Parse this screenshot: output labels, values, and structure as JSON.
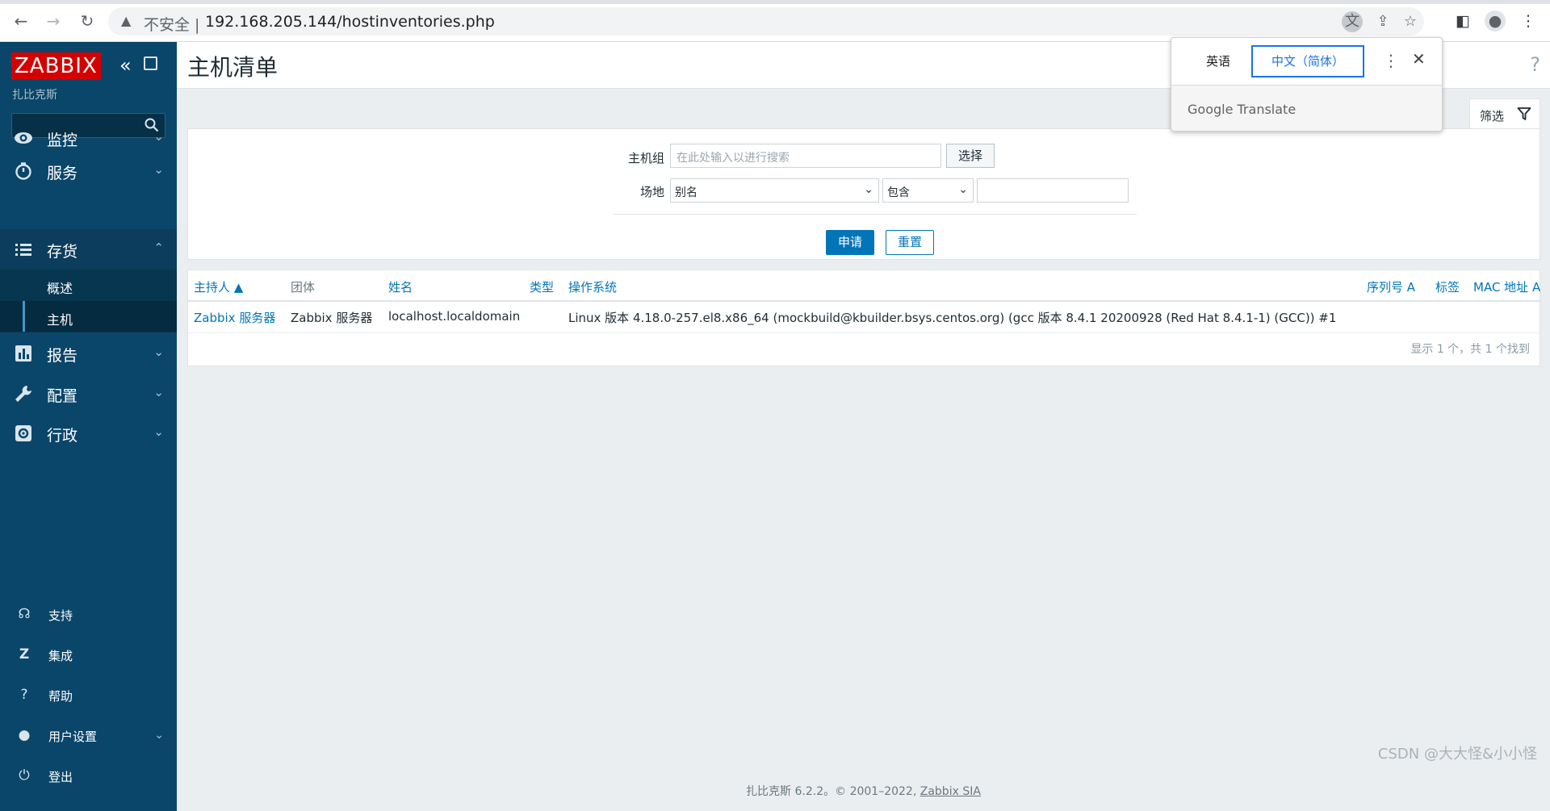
{
  "browser": {
    "insecure_label": "不安全 |",
    "url": "192.168.205.144/hostinventories.php"
  },
  "sidebar": {
    "logo": "ZABBIX",
    "subtitle": "扎比克斯",
    "search_placeholder": "",
    "menu": [
      {
        "label": "监控",
        "icon": "eye-icon"
      },
      {
        "label": "服务",
        "icon": "stopwatch-icon"
      },
      {
        "label": "存货",
        "icon": "list-icon"
      },
      {
        "label": "报告",
        "icon": "bar-chart-icon"
      },
      {
        "label": "配置",
        "icon": "wrench-icon"
      },
      {
        "label": "行政",
        "icon": "gear-icon"
      }
    ],
    "submenu": [
      {
        "label": "概述"
      },
      {
        "label": "主机"
      }
    ],
    "bottom": [
      {
        "label": "支持",
        "icon": "headset-icon"
      },
      {
        "label": "集成",
        "icon": "integrations-icon"
      },
      {
        "label": "帮助",
        "icon": "help-icon"
      },
      {
        "label": "用户设置",
        "icon": "user-icon"
      },
      {
        "label": "登出",
        "icon": "power-icon"
      }
    ]
  },
  "header": {
    "title": "主机清单",
    "help": "?"
  },
  "filter": {
    "tab_label": "筛选",
    "host_group_label": "主机组",
    "host_group_placeholder": "在此处输入以进行搜索",
    "select_button": "选择",
    "field_label": "场地",
    "field_value": "别名",
    "operator_value": "包含",
    "apply_button": "申请",
    "reset_button": "重置"
  },
  "table": {
    "headers": {
      "host": "主持人 ▲",
      "group": "团体",
      "name": "姓名",
      "type": "类型",
      "os": "操作系统",
      "serial": "序列号 A",
      "tag": "标签",
      "mac": "MAC 地址 A"
    },
    "rows": [
      {
        "host": "Zabbix 服务器",
        "group": "Zabbix 服务器",
        "name": "localhost.localdomain",
        "type": "",
        "os": "Linux 版本 4.18.0-257.el8.x86_64 (mockbuild@kbuilder.bsys.centos.org) (gcc 版本 8.4.1 20200928 (Red Hat 8.4.1-1) (GCC)) #1",
        "serial": "",
        "tag": "",
        "mac": ""
      }
    ],
    "paging": "显示 1 个，共 1 个找到"
  },
  "footer": {
    "text": "扎比克斯 6.2.2。© 2001–2022, ",
    "link": "Zabbix SIA"
  },
  "watermark": "CSDN @大大怪&小小怪",
  "translate_popup": {
    "lang_source": "英语",
    "lang_target": "中文（简体）",
    "brand": "Google Translate"
  },
  "colors": {
    "sidebar_bg": "#0a466a",
    "accent": "#0275b8",
    "logo_red": "#d40000"
  }
}
